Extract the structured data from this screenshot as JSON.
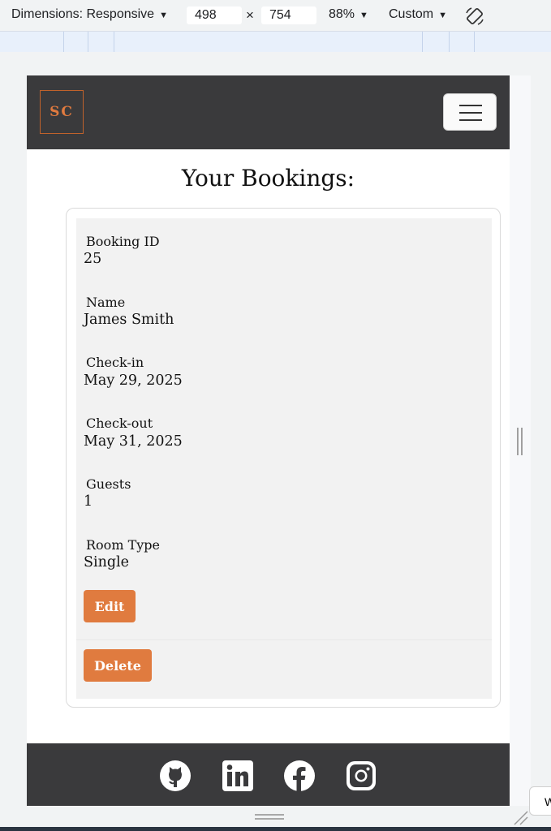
{
  "devtools": {
    "dimensions_label": "Dimensions: Responsive",
    "width_value": "498",
    "times_sign": "×",
    "height_value": "754",
    "zoom": "88%",
    "throttle": "Custom",
    "partial_tab": "W"
  },
  "brand": {
    "logo_text": "SC",
    "accent": "#e07b3f",
    "nav_bg": "#3a3a3c"
  },
  "page": {
    "heading": "Your Bookings:"
  },
  "booking": {
    "fields": [
      {
        "label": "Booking ID",
        "value": "25"
      },
      {
        "label": "Name",
        "value": "James Smith"
      },
      {
        "label": "Check-in",
        "value": "May 29, 2025"
      },
      {
        "label": "Check-out",
        "value": "May 31, 2025"
      },
      {
        "label": "Guests",
        "value": "1"
      },
      {
        "label": "Room Type",
        "value": "Single"
      }
    ],
    "edit_label": "Edit",
    "delete_label": "Delete"
  },
  "footer": {
    "icons": [
      "github-icon",
      "linkedin-icon",
      "facebook-icon",
      "instagram-icon"
    ]
  }
}
